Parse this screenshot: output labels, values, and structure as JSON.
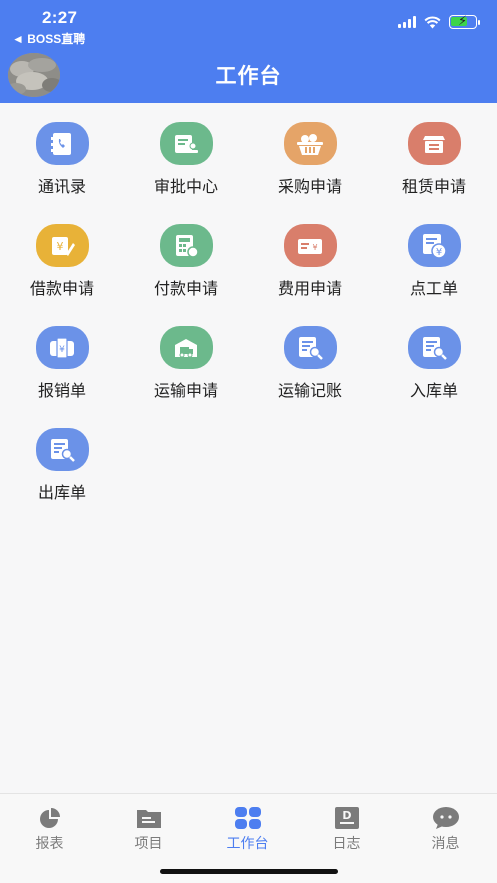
{
  "status_bar": {
    "time": "2:27",
    "back_app": "◄ BOSS直聘"
  },
  "nav": {
    "title": "工作台"
  },
  "tiles": [
    {
      "label": "通讯录",
      "color": "#6b92e8",
      "icon": "contacts-icon"
    },
    {
      "label": "审批中心",
      "color": "#6cb98c",
      "icon": "approval-icon"
    },
    {
      "label": "采购申请",
      "color": "#e5a468",
      "icon": "basket-icon"
    },
    {
      "label": "租赁申请",
      "color": "#d97e6b",
      "icon": "lease-box-icon"
    },
    {
      "label": "借款申请",
      "color": "#e8b238",
      "icon": "loan-note-icon"
    },
    {
      "label": "付款申请",
      "color": "#6cb98c",
      "icon": "calculator-icon"
    },
    {
      "label": "费用申请",
      "color": "#d97e6b",
      "icon": "cash-icon"
    },
    {
      "label": "点工单",
      "color": "#6b92e8",
      "icon": "yen-sheet-icon"
    },
    {
      "label": "报销单",
      "color": "#6b92e8",
      "icon": "wallet-yen-icon"
    },
    {
      "label": "运输申请",
      "color": "#6cb98c",
      "icon": "truck-icon"
    },
    {
      "label": "运输记账",
      "color": "#6b92e8",
      "icon": "ledger-search-icon"
    },
    {
      "label": "入库单",
      "color": "#6b92e8",
      "icon": "inbound-search-icon"
    },
    {
      "label": "出库单",
      "color": "#6b92e8",
      "icon": "outbound-search-icon"
    }
  ],
  "tabbar": {
    "active": "工作台",
    "items": [
      {
        "label": "报表",
        "icon": "pie-chart-icon"
      },
      {
        "label": "项目",
        "icon": "folder-icon"
      },
      {
        "label": "工作台",
        "icon": "grid-icon"
      },
      {
        "label": "日志",
        "icon": "log-icon"
      },
      {
        "label": "消息",
        "icon": "chat-bubble-icon"
      }
    ]
  },
  "colors": {
    "brand": "#4d7ef0",
    "tab_inactive": "#7b7b7b"
  }
}
